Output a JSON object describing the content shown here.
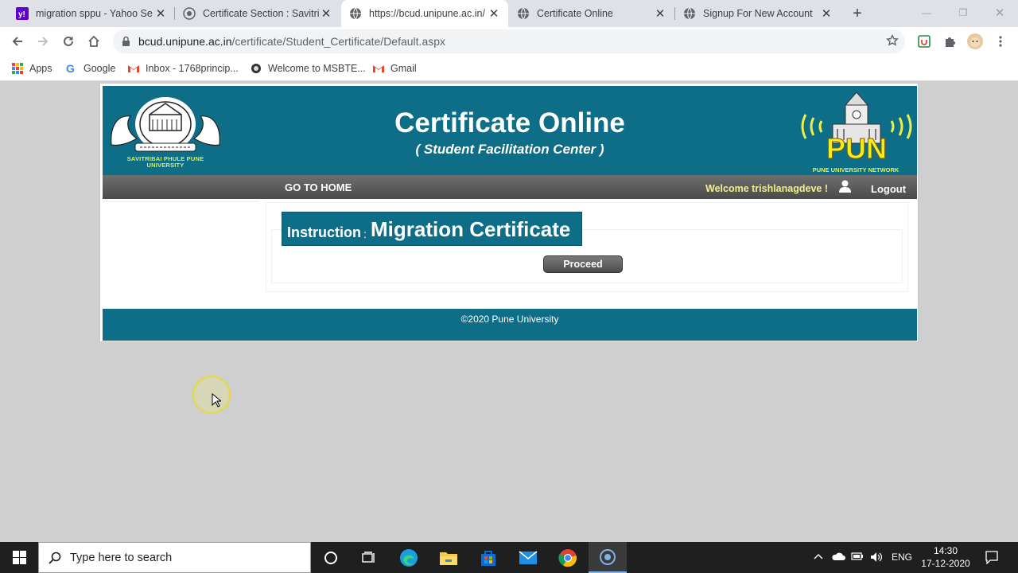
{
  "browser": {
    "tabs": [
      {
        "title": "migration sppu - Yahoo Se",
        "icon": "yahoo-icon"
      },
      {
        "title": "Certificate Section : Savitrib",
        "icon": "seal-icon"
      },
      {
        "title": "https://bcud.unipune.ac.in/",
        "icon": "globe-icon"
      },
      {
        "title": "Certificate Online",
        "icon": "globe-icon"
      },
      {
        "title": "Signup For New Account",
        "icon": "globe-icon"
      }
    ],
    "url_host": "bcud.unipune.ac.in",
    "url_path": "/certificate/Student_Certificate/Default.aspx",
    "bookmarks": [
      {
        "label": "Apps",
        "icon": "apps-grid-icon"
      },
      {
        "label": "Google",
        "icon": "google-icon"
      },
      {
        "label": "Inbox - 1768princip...",
        "icon": "gmail-icon"
      },
      {
        "label": "Welcome to MSBTE...",
        "icon": "msbte-icon"
      },
      {
        "label": "Gmail",
        "icon": "gmail-icon"
      }
    ]
  },
  "page": {
    "seal_caption_line1": "SAVITRIBAI PHULE PUNE",
    "seal_caption_line2": "UNIVERSITY",
    "title": "Certificate Online",
    "subtitle": "( Student Facilitation Center )",
    "network_logo_text": "PUN",
    "network_caption": "PUNE UNIVERSITY NETWORK",
    "nav": {
      "home": "GO TO HOME",
      "welcome": "Welcome trishlanagdeve !",
      "logout": "Logout"
    },
    "instruction_label": "Instruction",
    "instruction_colon": ":",
    "instruction_value": "Migration Certificate",
    "proceed_button": "Proceed",
    "footer": "©2020 Pune University",
    "accent_color": "#0f6e87"
  },
  "taskbar": {
    "search_placeholder": "Type here to search",
    "language": "ENG",
    "time": "14:30",
    "date": "17-12-2020"
  }
}
